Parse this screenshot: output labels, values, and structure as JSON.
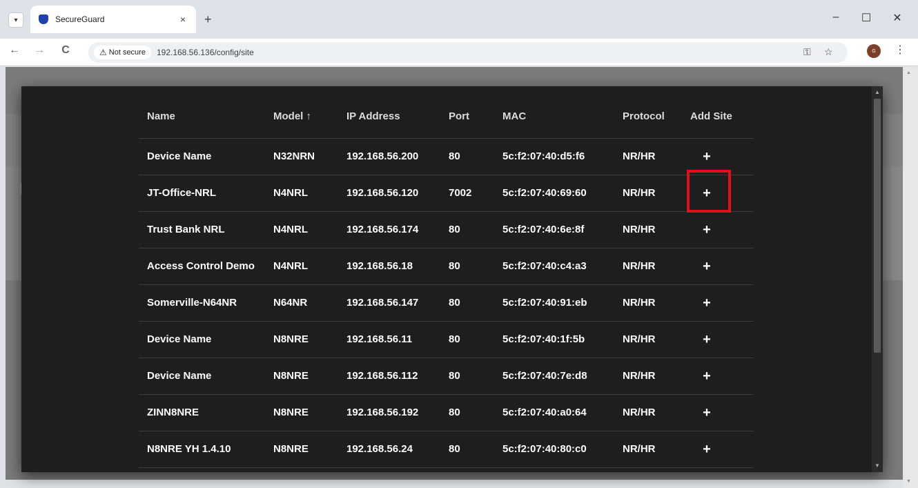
{
  "browser": {
    "tab_title": "SecureGuard",
    "tab_close": "×",
    "new_tab": "+",
    "window_controls": {
      "minimize": "–",
      "maximize": "☐",
      "close": "✕"
    },
    "nav": {
      "back": "←",
      "forward": "→",
      "reload": "C"
    },
    "security_label": "Not secure",
    "url": "192.168.56.136/config/site",
    "profile_initial": "G",
    "menu": "⋮"
  },
  "table": {
    "headers": {
      "name": "Name",
      "model": "Model",
      "sort_indicator": "↑",
      "ip": "IP Address",
      "port": "Port",
      "mac": "MAC",
      "protocol": "Protocol",
      "add_site": "Add Site"
    },
    "add_symbol": "+",
    "rows": [
      {
        "name": "Device Name",
        "model": "N32NRN",
        "ip": "192.168.56.200",
        "port": "80",
        "mac": "5c:f2:07:40:d5:f6",
        "protocol": "NR/HR"
      },
      {
        "name": "JT-Office-NRL",
        "model": "N4NRL",
        "ip": "192.168.56.120",
        "port": "7002",
        "mac": "5c:f2:07:40:69:60",
        "protocol": "NR/HR"
      },
      {
        "name": "Trust Bank NRL",
        "model": "N4NRL",
        "ip": "192.168.56.174",
        "port": "80",
        "mac": "5c:f2:07:40:6e:8f",
        "protocol": "NR/HR"
      },
      {
        "name": "Access Control Demo",
        "model": "N4NRL",
        "ip": "192.168.56.18",
        "port": "80",
        "mac": "5c:f2:07:40:c4:a3",
        "protocol": "NR/HR"
      },
      {
        "name": "Somerville-N64NR",
        "model": "N64NR",
        "ip": "192.168.56.147",
        "port": "80",
        "mac": "5c:f2:07:40:91:eb",
        "protocol": "NR/HR"
      },
      {
        "name": "Device Name",
        "model": "N8NRE",
        "ip": "192.168.56.11",
        "port": "80",
        "mac": "5c:f2:07:40:1f:5b",
        "protocol": "NR/HR"
      },
      {
        "name": "Device Name",
        "model": "N8NRE",
        "ip": "192.168.56.112",
        "port": "80",
        "mac": "5c:f2:07:40:7e:d8",
        "protocol": "NR/HR"
      },
      {
        "name": "ZINN8NRE",
        "model": "N8NRE",
        "ip": "192.168.56.192",
        "port": "80",
        "mac": "5c:f2:07:40:a0:64",
        "protocol": "NR/HR"
      },
      {
        "name": "N8NRE YH 1.4.10",
        "model": "N8NRE",
        "ip": "192.168.56.24",
        "port": "80",
        "mac": "5c:f2:07:40:80:c0",
        "protocol": "NR/HR"
      }
    ]
  },
  "colors": {
    "modal_bg": "#1e1e1e",
    "highlight": "#e3101c",
    "favicon": "#1f3fae"
  }
}
